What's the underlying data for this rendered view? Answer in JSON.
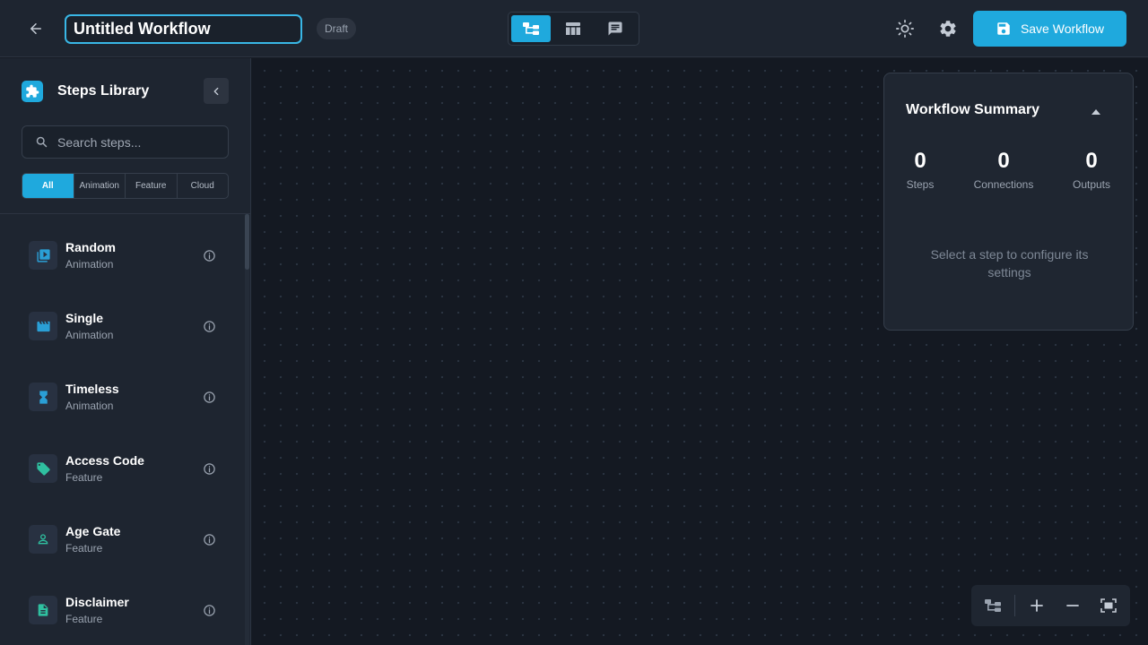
{
  "header": {
    "back_icon": "arrow-left-icon",
    "workflow_title": "Untitled Workflow",
    "status_badge": "Draft",
    "view_modes": [
      {
        "icon": "flow-tree-icon",
        "active": true
      },
      {
        "icon": "table-icon",
        "active": false
      },
      {
        "icon": "chat-icon",
        "active": false
      }
    ],
    "theme_icon": "sun-icon",
    "settings_icon": "gear-icon",
    "save_label": "Save Workflow",
    "save_icon": "floppy-disk-icon"
  },
  "sidebar": {
    "title": "Steps Library",
    "logo_icon": "puzzle-icon",
    "collapse_icon": "chevron-left-icon",
    "search_placeholder": "Search steps...",
    "filters": [
      {
        "label": "All",
        "active": true
      },
      {
        "label": "Animation",
        "active": false
      },
      {
        "label": "Feature",
        "active": false
      },
      {
        "label": "Cloud",
        "active": false
      }
    ],
    "steps": [
      {
        "name": "Random",
        "category": "Animation",
        "icon": "video-library-icon"
      },
      {
        "name": "Single",
        "category": "Animation",
        "icon": "clapperboard-icon"
      },
      {
        "name": "Timeless",
        "category": "Animation",
        "icon": "hourglass-icon"
      },
      {
        "name": "Access Code",
        "category": "Feature",
        "icon": "tag-icon"
      },
      {
        "name": "Age Gate",
        "category": "Feature",
        "icon": "person-icon"
      },
      {
        "name": "Disclaimer",
        "category": "Feature",
        "icon": "document-icon"
      }
    ]
  },
  "summary": {
    "title": "Workflow Summary",
    "stats": [
      {
        "value": "0",
        "label": "Steps"
      },
      {
        "value": "0",
        "label": "Connections"
      },
      {
        "value": "0",
        "label": "Outputs"
      }
    ],
    "hint": "Select a step to configure its settings"
  },
  "colors": {
    "accent": "#1fa9dd",
    "animation_icon": "#2a9fd6",
    "feature_icon": "#2fc0a0"
  },
  "zoom_controls": [
    "auto-layout-icon",
    "zoom-in-icon",
    "zoom-out-icon",
    "fit-view-icon"
  ]
}
